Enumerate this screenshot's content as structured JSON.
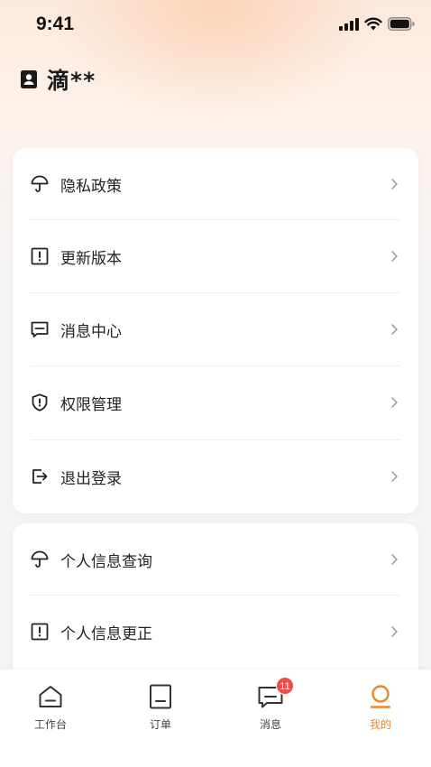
{
  "status_bar": {
    "time": "9:41",
    "icons": [
      "signal-icon",
      "wifi-icon",
      "battery-icon"
    ]
  },
  "header": {
    "icon": "user-badge-icon",
    "user_name": "滴**"
  },
  "menu_group_1": [
    {
      "icon": "umbrella-icon",
      "label": "隐私政策"
    },
    {
      "icon": "alert-square-icon",
      "label": "更新版本"
    },
    {
      "icon": "message-icon",
      "label": "消息中心"
    },
    {
      "icon": "shield-icon",
      "label": "权限管理"
    },
    {
      "icon": "logout-icon",
      "label": "退出登录"
    }
  ],
  "menu_group_2": [
    {
      "icon": "umbrella-icon",
      "label": "个人信息查询"
    },
    {
      "icon": "alert-square-icon",
      "label": "个人信息更正"
    }
  ],
  "tabbar": {
    "tabs": [
      {
        "icon": "home-icon",
        "label": "工作台",
        "active": false
      },
      {
        "icon": "order-icon",
        "label": "订单",
        "active": false
      },
      {
        "icon": "message-icon",
        "label": "消息",
        "active": false,
        "badge": "11"
      },
      {
        "icon": "profile-icon",
        "label": "我的",
        "active": true
      }
    ]
  },
  "colors": {
    "accent": "#e8892a",
    "badge": "#ee4d4d",
    "text": "#222222"
  }
}
